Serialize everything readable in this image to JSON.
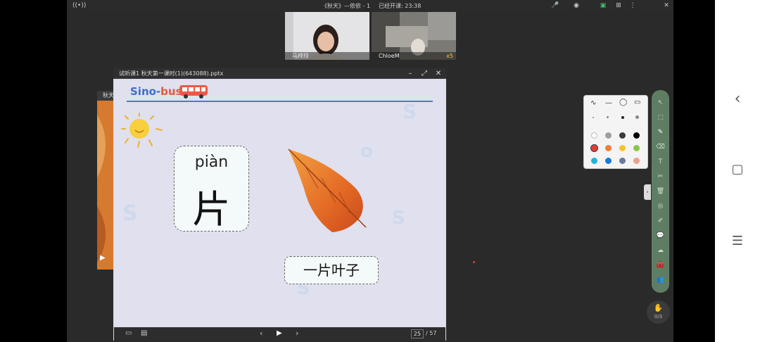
{
  "topbar": {
    "title": "《秋天》—依依 - 1",
    "timer": "已经开课: 23:38"
  },
  "videos": [
    {
      "name": "马梓玲"
    },
    {
      "name": "ChloeM",
      "badge": "x5"
    }
  ],
  "background_doc": {
    "title": "秋天"
  },
  "ppt_window": {
    "title": "试听课1 秋天第一课时(1)(643088).pptx"
  },
  "slide": {
    "brand_part1": "Sino-",
    "brand_part2": "bus",
    "pinyin": "piàn",
    "hanzi": "片",
    "phrase": "一片叶子"
  },
  "slide_nav": {
    "current_page": "25",
    "total_pages": "/ 57"
  },
  "colors": {
    "accent_green": "#5f7d63",
    "brand_blue": "#3d6fc8",
    "brand_red": "#e25a3b",
    "selected_pen": "#e53935"
  },
  "pen_colors": [
    "#ffffff",
    "#9e9e9e",
    "#3a3a3a",
    "#000000",
    "#e53935",
    "#ef7d3c",
    "#f4c430",
    "#8bc34a",
    "#1fb6d6",
    "#1e78d6",
    "#6b7a99",
    "#e8a28d"
  ],
  "bottom_right": {
    "counter": "0/3"
  }
}
